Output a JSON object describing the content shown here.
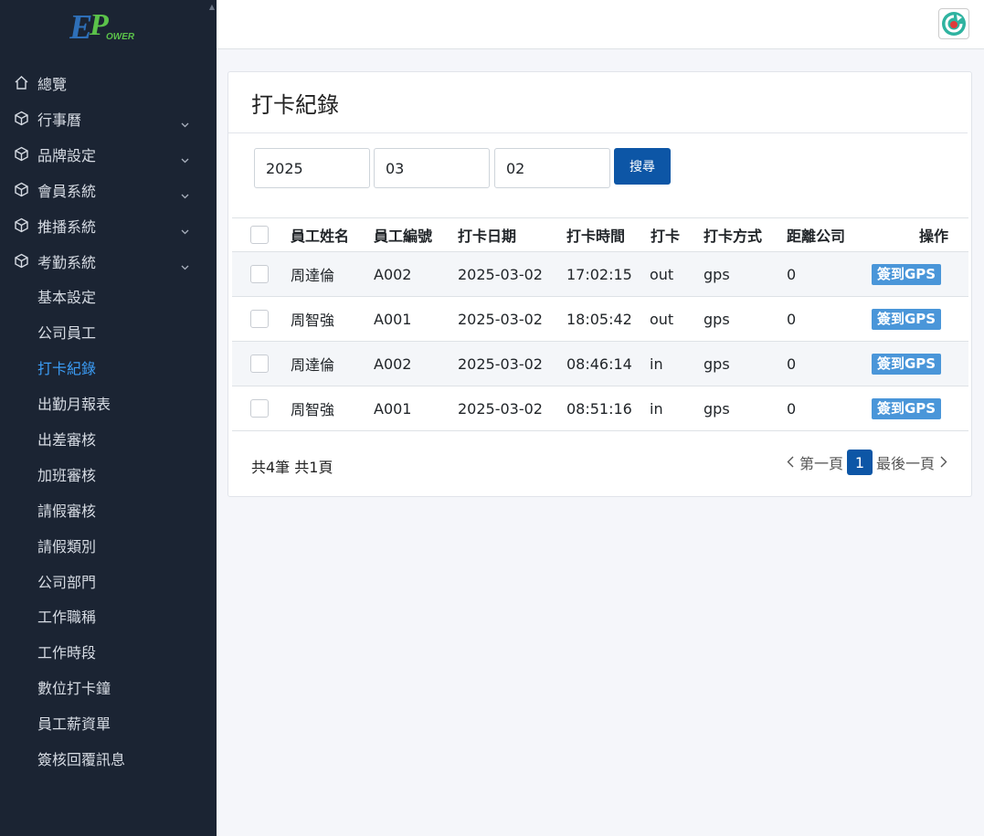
{
  "sidebar": {
    "logo_text": "EPower",
    "menu": [
      {
        "label": "總覽",
        "icon": "home-icon",
        "expandable": false
      },
      {
        "label": "行事曆",
        "icon": "cube-icon",
        "expandable": true
      },
      {
        "label": "品牌設定",
        "icon": "cube-icon",
        "expandable": true
      },
      {
        "label": "會員系統",
        "icon": "cube-icon",
        "expandable": true
      },
      {
        "label": "推播系統",
        "icon": "cube-icon",
        "expandable": true
      },
      {
        "label": "考勤系統",
        "icon": "cube-icon",
        "expandable": true
      }
    ],
    "submenu": [
      {
        "label": "基本設定"
      },
      {
        "label": "公司員工"
      },
      {
        "label": "打卡紀錄",
        "active": true
      },
      {
        "label": "出勤月報表"
      },
      {
        "label": "出差審核"
      },
      {
        "label": "加班審核"
      },
      {
        "label": "請假審核"
      },
      {
        "label": "請假類別"
      },
      {
        "label": "公司部門"
      },
      {
        "label": "工作職稱"
      },
      {
        "label": "工作時段"
      },
      {
        "label": "數位打卡鐘"
      },
      {
        "label": "員工薪資單"
      },
      {
        "label": "簽核回覆訊息"
      }
    ]
  },
  "page": {
    "title": "打卡紀錄"
  },
  "filters": {
    "year": "2025",
    "month": "03",
    "day": "02",
    "search_label": "搜尋"
  },
  "table": {
    "columns": [
      "員工姓名",
      "員工編號",
      "打卡日期",
      "打卡時間",
      "打卡",
      "打卡方式",
      "距離公司",
      "操作"
    ],
    "rows": [
      {
        "name": "周達倫",
        "id": "A002",
        "date": "2025-03-02",
        "time": "17:02:15",
        "type": "out",
        "method": "gps",
        "distance": "0",
        "action": "簽到GPS"
      },
      {
        "name": "周智強",
        "id": "A001",
        "date": "2025-03-02",
        "time": "18:05:42",
        "type": "out",
        "method": "gps",
        "distance": "0",
        "action": "簽到GPS"
      },
      {
        "name": "周達倫",
        "id": "A002",
        "date": "2025-03-02",
        "time": "08:46:14",
        "type": "in",
        "method": "gps",
        "distance": "0",
        "action": "簽到GPS"
      },
      {
        "name": "周智強",
        "id": "A001",
        "date": "2025-03-02",
        "time": "08:51:16",
        "type": "in",
        "method": "gps",
        "distance": "0",
        "action": "簽到GPS"
      }
    ]
  },
  "footer": {
    "summary": "共4筆 共1頁",
    "first_page": "第一頁",
    "current_page": "1",
    "last_page": "最後一頁"
  },
  "colors": {
    "sidebar_bg": "#1b2433",
    "active": "#3b9cf5",
    "primary": "#0d56a6",
    "gps_button": "#4a96d9"
  }
}
